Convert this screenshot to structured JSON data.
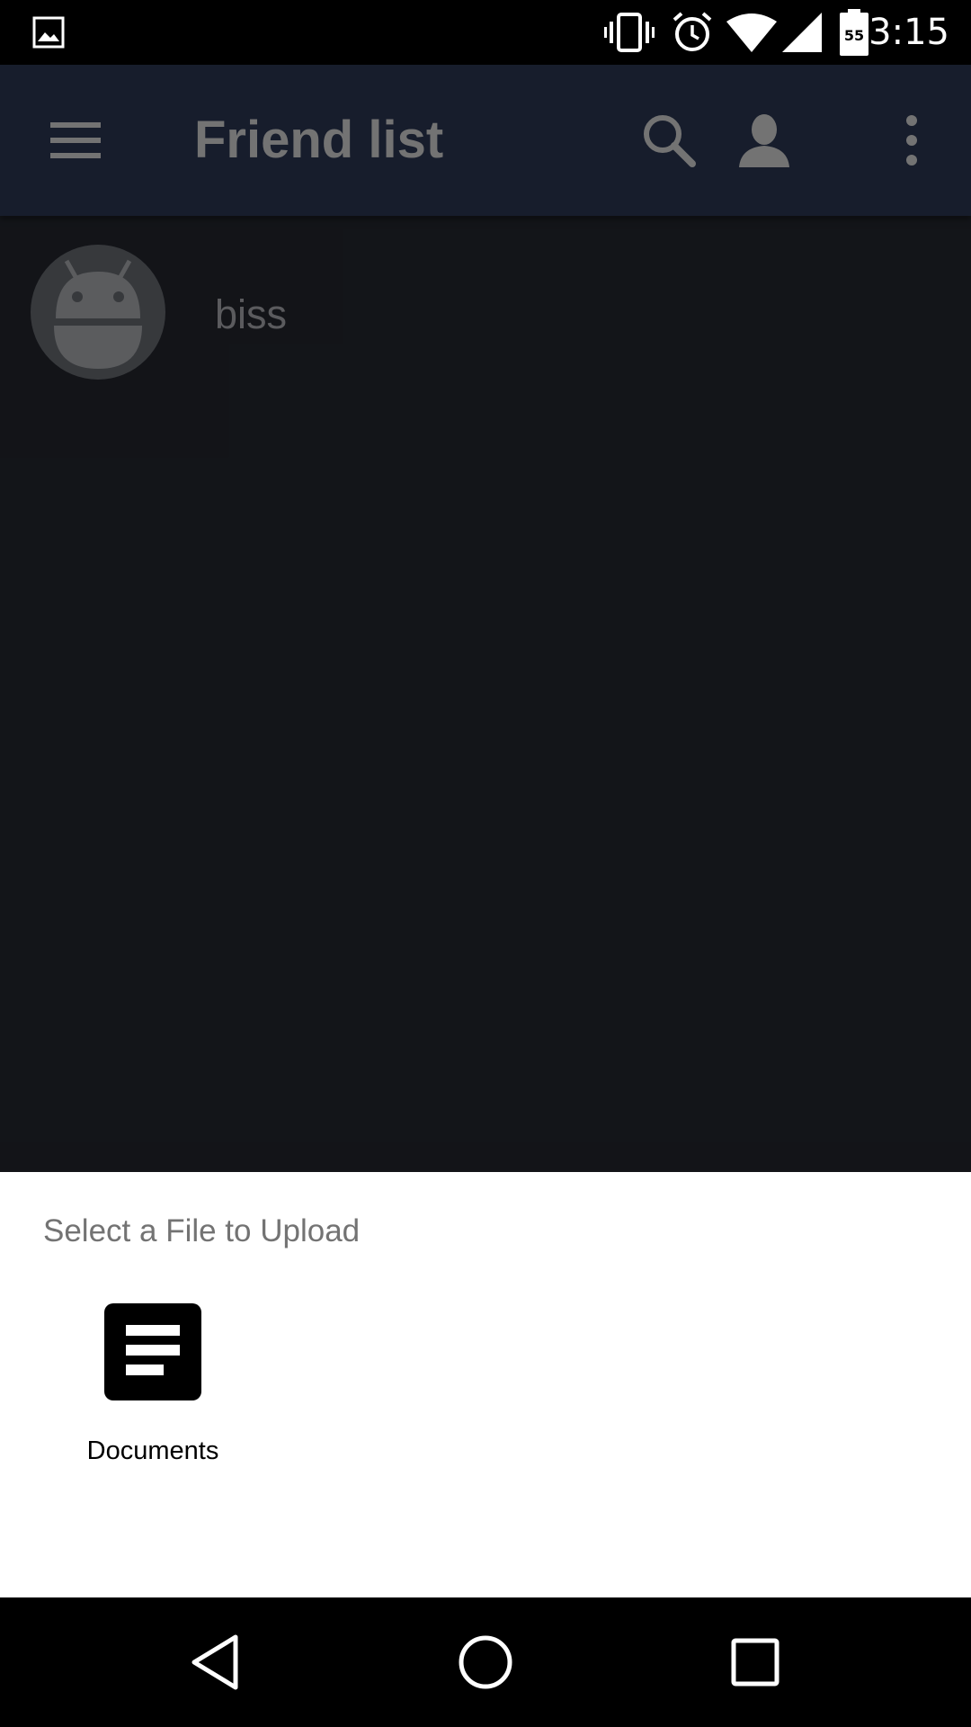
{
  "status_bar": {
    "time": "3:15",
    "battery_level": "55",
    "icons": [
      "image-icon",
      "vibrate-icon",
      "alarm-icon",
      "wifi-icon",
      "signal-icon",
      "battery-icon"
    ]
  },
  "app_bar": {
    "title": "Friend list",
    "icons": [
      "menu-icon",
      "search-icon",
      "person-icon",
      "more-vert-icon"
    ]
  },
  "friends": [
    {
      "name": "biss",
      "avatar": "android-avatar"
    }
  ],
  "bottom_sheet": {
    "title": "Select a File to Upload",
    "items": [
      {
        "label": "Documents",
        "icon": "documents-icon"
      }
    ]
  },
  "nav_bar": {
    "buttons": [
      "back-icon",
      "home-icon",
      "recents-icon"
    ]
  },
  "colors": {
    "app_bar": "#334162",
    "background": "#2a2e37",
    "sheet": "#ffffff"
  }
}
